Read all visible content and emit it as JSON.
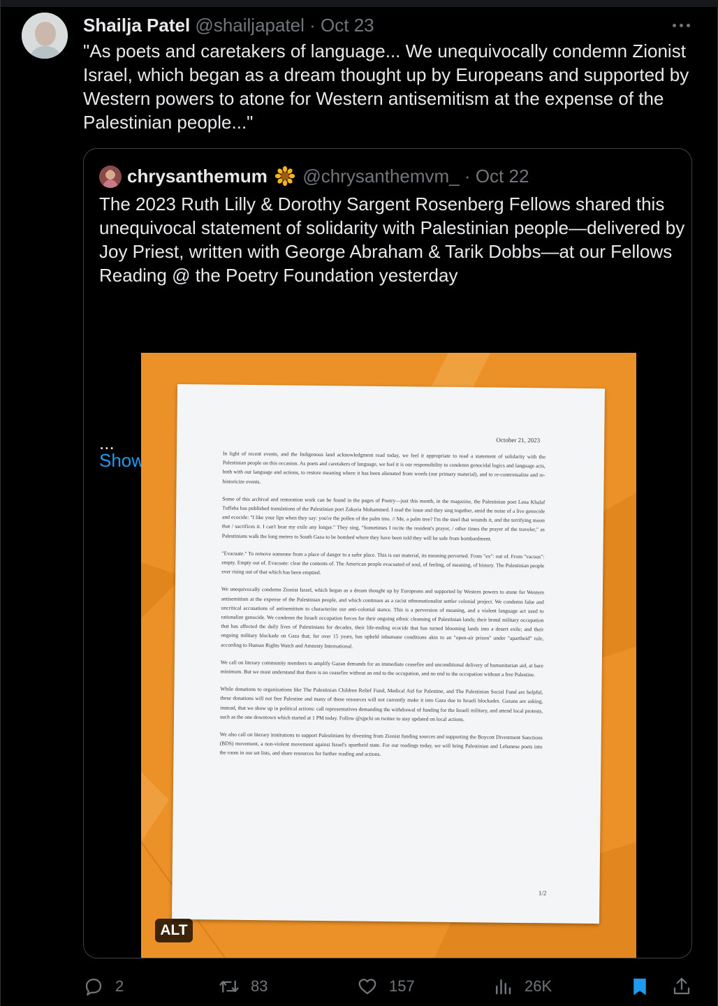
{
  "tweet": {
    "author_name": "Shailja Patel",
    "author_handle": "@shailjapatel",
    "separator": "·",
    "date": "Oct 23",
    "text": "\"As poets and caretakers of language... We unequivocally condemn Zionist Israel, which began as a dream thought up by Europeans and supported by Western powers to atone for Western antisemitism at the expense of the Palestinian people...\""
  },
  "quote": {
    "author_name": "chrysanthemum",
    "author_handle": "@chrysanthemvm_",
    "separator": "·",
    "date": "Oct 22",
    "text": "The 2023 Ruth Lilly & Dorothy Sargent Rosenberg Fellows shared this unequivocal statement of solidarity with Palestinian people—delivered by Joy Priest, written with George Abraham & Tarik Dobbs—at our Fellows Reading @ the Poetry Foundation yesterday",
    "ellipsis": "...",
    "show_more": "Show more",
    "alt_badge": "ALT"
  },
  "document": {
    "date": "October 21, 2023",
    "page_number": "1/2",
    "paragraphs": [
      "In light of recent events, and the Indigenous land acknowledgment read today, we feel it appropriate to read a statement of solidarity with the Palestinian people on this occasion. As poets and caretakers of language, we feel it is our responsibility to condemn genocidal logics and language acts, both with our language and actions, to restore meaning where it has been alienated from words (our primary material), and to re-contextualize and re-historicize events.",
      "Some of this archival and restoration work can be found in the pages of Poetry—just this month, in the magazine, the Palestinian poet Lena Khalaf Tuffaha has published translations of the Palestinian poet Zakaria Mohammed. I read the issue and they sing together, amid the noise of a live genocide and ecocide: \"I like your lips when they say: you're the pollen of the palm tree. // Me, a palm tree? I'm the steel that wounds it, and the terrifying moon that / sacrifices it. I can't bear my exile any longer.\" They sing, \"Sometimes I recite the resident's prayer, / other times the prayer of the traveler,\" as Palestinians walk the long metres to South Gaza to be bombed where they have been told they will be safe from bombardment.",
      "\"Evacuate.\" To remove someone from a place of danger to a safer place. This is our material, its meaning perverted. From \"ex\": out of. From \"vacuus\": empty. Empty out of. Evacuate: clear the contents of. The American people evacuated of soul, of feeling, of meaning, of history. The Palestinian people ever rising out of that which has been emptied.",
      "We unequivocally condemn Zionist Israel, which began as a dream thought up by Europeans and supported by Western powers to atone for Western antisemitism at the expense of the Palestinian people, and which continues as a racist ethnonationalist settler colonial project. We condemn false and uncritical accusations of antisemitism to characterize our anti-colonial stance. This is a perversion of meaning, and a violent language act used to rationalize genocide. We condemn the Israeli occupation forces for their ongoing ethnic cleansing of Palestinian lands; their brutal military occupation that has affected the daily lives of Palestinians for decades, their life-ending ecocide that has turned blooming lands into a desert exile; and their ongoing military blockade on Gaza that, for over 15 years, has upheld inhumane conditions akin to an \"open-air prison\" under \"apartheid\" rule, according to Human Rights Watch and Amnesty International.",
      "We call on literary community members to amplify Gazan demands for an immediate ceasefire and unconditional delivery of humanitarian aid, at bare minimum. But we must understand that there is no ceasefire without an end to the occupation, and no end to the occupation without a free Palestine.",
      "While donations to organizations like The Palestinian Children Relief Fund, Medical Aid for Palestine, and The Palestinian Social Fund are helpful, these donations will not free Palestine and many of these resources will not currently make it into Gaza due to Israeli blockades. Gazans are asking, instead, that we show up in political actions: call representatives demanding the withdrawal of funding for the Israeli military, and attend local protests, such as the one downtown which started at 1 PM today. Follow @sjpchi on twitter to stay updated on local actions.",
      "We also call on literary institutions to support Palestinians by divesting from Zionist funding sources and supporting the Boycott Divestment Sanctions (BDS) movement, a non-violent movement against Israel's apartheid state. For our readings today, we will bring Palestinian and Lebanese poets into the room in our set lists, and share resources for further reading and actions."
    ]
  },
  "actions": {
    "replies": "2",
    "reposts": "83",
    "likes": "157",
    "views": "26K"
  },
  "colors": {
    "accent": "#1d9bf0",
    "muted": "#71767b",
    "background": "#000000",
    "folder": "#e88a1e"
  }
}
